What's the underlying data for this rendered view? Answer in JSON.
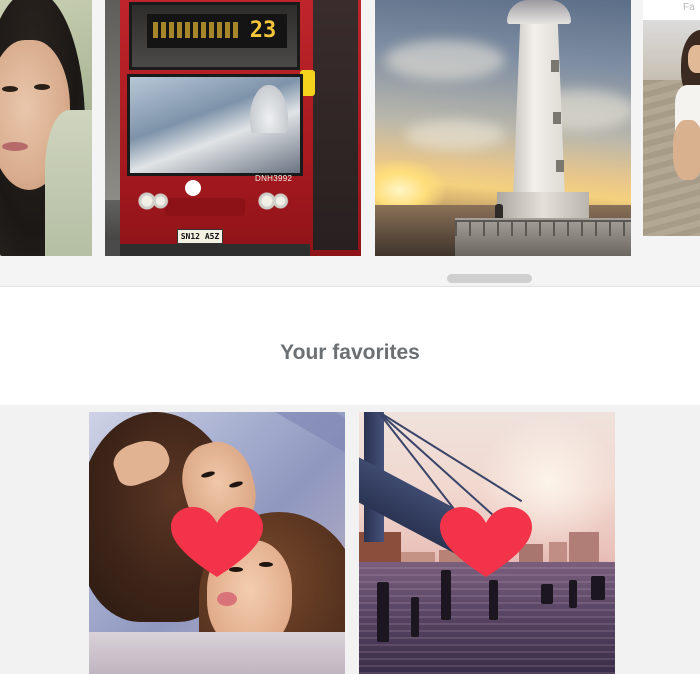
{
  "carousel": {
    "bus_route_number": "23",
    "bus_reg_code": "DNH3992",
    "bus_plate": "SN12 A5Z",
    "partial_tile_label": "Fa",
    "scroll_position_fraction": 0.64
  },
  "favorites": {
    "title": "Your favorites",
    "heart_color": "#f2334a"
  },
  "colors": {
    "background": "#f2f2f2",
    "title_text": "#6c7073",
    "heart": "#f2334a"
  },
  "icons": {
    "favorite": "heart-icon"
  }
}
